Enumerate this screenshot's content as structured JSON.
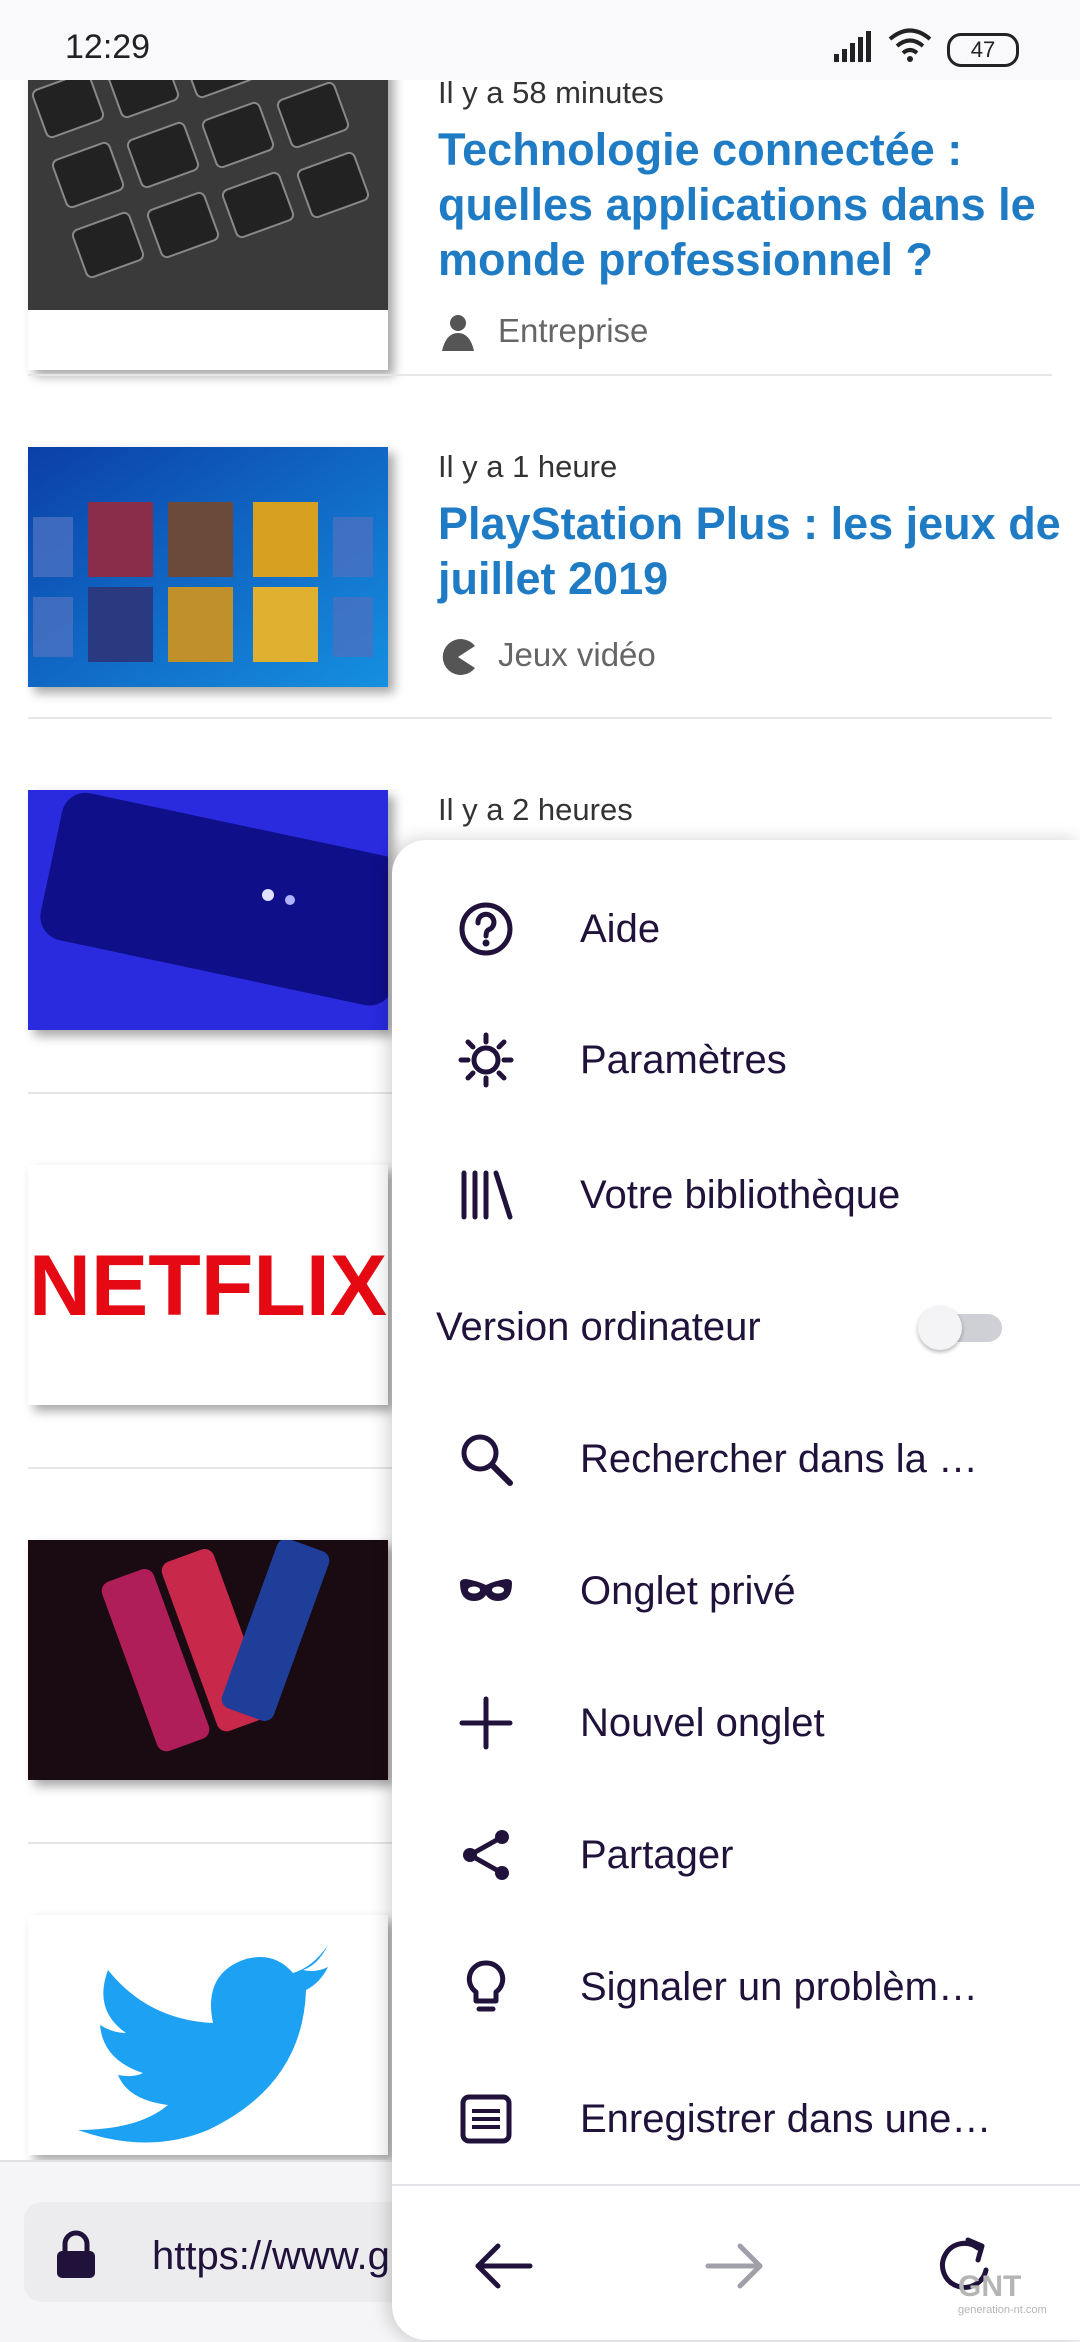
{
  "status_bar": {
    "time": "12:29",
    "battery": "47"
  },
  "articles": [
    {
      "time_ago": "Il y a 58 minutes",
      "headline": "Technologie connectée : quelles applications dans le monde professionnel ?",
      "category": "Entreprise",
      "category_icon": "person-icon",
      "thumb": "keyboard"
    },
    {
      "time_ago": "Il y a 1 heure",
      "headline": "PlayStation Plus : les jeux de juillet 2019",
      "category": "Jeux vidéo",
      "category_icon": "pacman-icon",
      "thumb": "games"
    },
    {
      "time_ago": "Il y a 2 heures",
      "thumb": "phone"
    },
    {
      "thumb": "netflix",
      "logo_text": "NETFLIX"
    },
    {
      "thumb": "phones"
    },
    {
      "thumb": "twitter"
    }
  ],
  "url_bar": {
    "url": "https://www.g"
  },
  "menu": {
    "items": [
      {
        "label": "Aide",
        "icon": "help-icon"
      },
      {
        "label": "Paramètres",
        "icon": "gear-icon"
      },
      {
        "label": "Votre bibliothèque",
        "icon": "library-icon"
      },
      {
        "label": "Version ordinateur",
        "toggle": false
      },
      {
        "label": "Rechercher dans la …",
        "icon": "search-icon"
      },
      {
        "label": "Onglet privé",
        "icon": "mask-icon"
      },
      {
        "label": "Nouvel onglet",
        "icon": "plus-icon"
      },
      {
        "label": "Partager",
        "icon": "share-icon"
      },
      {
        "label": "Signaler un problèm…",
        "icon": "bulb-icon"
      },
      {
        "label": "Enregistrer dans une…",
        "icon": "reader-icon"
      }
    ],
    "nav": {
      "back": "back-arrow-icon",
      "forward": "forward-arrow-icon",
      "reload": "reload-icon"
    }
  },
  "watermark": {
    "logo": "GNT",
    "site": "generation-nt.com"
  },
  "colors": {
    "headline": "#1f7cc4",
    "menu_text": "#20123a"
  }
}
